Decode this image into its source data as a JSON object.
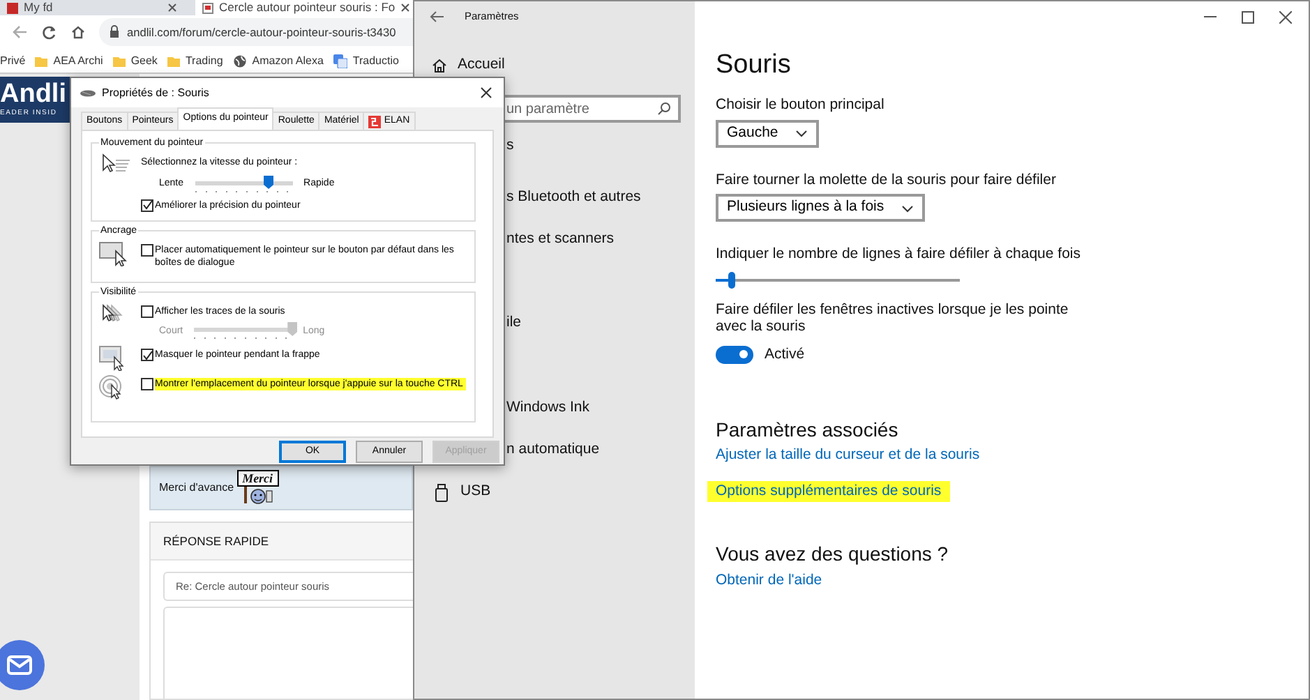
{
  "browser": {
    "tabs": [
      {
        "title": "My fd",
        "selected": false
      },
      {
        "title": "Cercle autour pointeur souris : Fo",
        "selected": true
      }
    ],
    "address": "andlil.com/forum/cercle-autour-pointeur-souris-t3430",
    "bookmarks": [
      {
        "label": "Privé",
        "kind": "plain"
      },
      {
        "label": "AEA Archi",
        "kind": "folder"
      },
      {
        "label": "Geek",
        "kind": "folder"
      },
      {
        "label": "Trading",
        "kind": "folder"
      },
      {
        "label": "Amazon Alexa",
        "kind": "globe"
      },
      {
        "label": "Traductio",
        "kind": "translate"
      }
    ],
    "logo": {
      "name": "Andli",
      "tagline": "EADER INSID"
    },
    "post": {
      "text": "Merci d'avance",
      "sign": "Merci"
    },
    "quick_reply": {
      "title": "RÉPONSE RAPIDE",
      "subject": "Re: Cercle autour pointeur souris"
    }
  },
  "settings": {
    "title": "Paramètres",
    "home": "Accueil",
    "search": {
      "placeholder": "un paramètre"
    },
    "nav": [
      {
        "label": "s",
        "kind": "partial"
      },
      {
        "label": "s Bluetooth et autres",
        "kind": "partial"
      },
      {
        "label": "ntes et scanners",
        "kind": "partial"
      },
      {
        "label": "ile",
        "kind": "partial"
      },
      {
        "label": "Windows Ink",
        "kind": "partial"
      },
      {
        "label": "n automatique",
        "kind": "partial"
      },
      {
        "label": "USB",
        "kind": "usb"
      }
    ],
    "heading": "Souris",
    "sections": [
      {
        "kind": "dropdown",
        "label": "Choisir le bouton principal",
        "value": "Gauche"
      },
      {
        "kind": "dropdown",
        "label": "Faire tourner la molette de la souris pour faire défiler",
        "value": "Plusieurs lignes à la fois"
      },
      {
        "kind": "slider",
        "label": "Indiquer le nombre de lignes à faire défiler à chaque fois",
        "level": 0.06
      },
      {
        "kind": "toggle",
        "label": "Faire défiler les fenêtres inactives lorsque je les pointe avec la souris",
        "on": true,
        "state_text": "Activé"
      }
    ],
    "related": {
      "title": "Paramètres associés",
      "links": [
        {
          "text": "Ajuster la taille du curseur et de la souris",
          "highlighted": false
        },
        {
          "text": "Options supplémentaires de souris",
          "highlighted": true
        }
      ]
    },
    "help": {
      "title": "Vous avez des questions ?",
      "link": "Obtenir de l'aide"
    }
  },
  "dialog": {
    "title": "Propriétés de : Souris",
    "tabs": [
      {
        "label": "Boutons",
        "kind": "plain",
        "selected": false
      },
      {
        "label": "Pointeurs",
        "kind": "plain",
        "selected": false
      },
      {
        "label": "Options du pointeur",
        "kind": "plain",
        "selected": true
      },
      {
        "label": "Roulette",
        "kind": "plain",
        "selected": false
      },
      {
        "label": "Matériel",
        "kind": "plain",
        "selected": false
      },
      {
        "label": "ELAN",
        "kind": "vendor",
        "selected": false
      }
    ],
    "groups": [
      {
        "title": "Mouvement du pointeur",
        "rows": [
          {
            "items": [
              {
                "kind": "text",
                "text": "Sélectionnez la vitesse du pointeur :"
              },
              {
                "kind": "slider",
                "min_label": "Lente",
                "max_label": "Rapide",
                "level": 0.75,
                "disabled": false
              },
              {
                "kind": "checkbox",
                "text": "Améliorer la précision du pointeur",
                "checked": true,
                "highlighted": false
              }
            ]
          }
        ]
      },
      {
        "title": "Ancrage",
        "rows": [
          {
            "items": [
              {
                "kind": "checkbox",
                "text": "Placer automatiquement le pointeur sur le bouton par défaut dans les boîtes de dialogue",
                "checked": false,
                "highlighted": false
              }
            ]
          }
        ]
      },
      {
        "title": "Visibilité",
        "rows": [
          {
            "items": [
              {
                "kind": "checkbox",
                "text": "Afficher les traces de la souris",
                "checked": false,
                "highlighted": false
              },
              {
                "kind": "slider",
                "min_label": "Court",
                "max_label": "Long",
                "level": 1,
                "disabled": true
              }
            ]
          },
          {
            "items": [
              {
                "kind": "checkbox",
                "text": "Masquer le pointeur pendant la frappe",
                "checked": true,
                "highlighted": false
              }
            ]
          },
          {
            "items": [
              {
                "kind": "checkbox",
                "text": "Montrer l'emplacement du pointeur lorsque j'appuie sur la touche CTRL",
                "checked": false,
                "highlighted": true
              }
            ]
          }
        ]
      }
    ],
    "buttons": [
      {
        "label": "OK",
        "kind": "default",
        "disabled": false
      },
      {
        "label": "Annuler",
        "kind": "normal",
        "disabled": false
      },
      {
        "label": "Appliquer",
        "kind": "normal",
        "disabled": true
      }
    ]
  }
}
